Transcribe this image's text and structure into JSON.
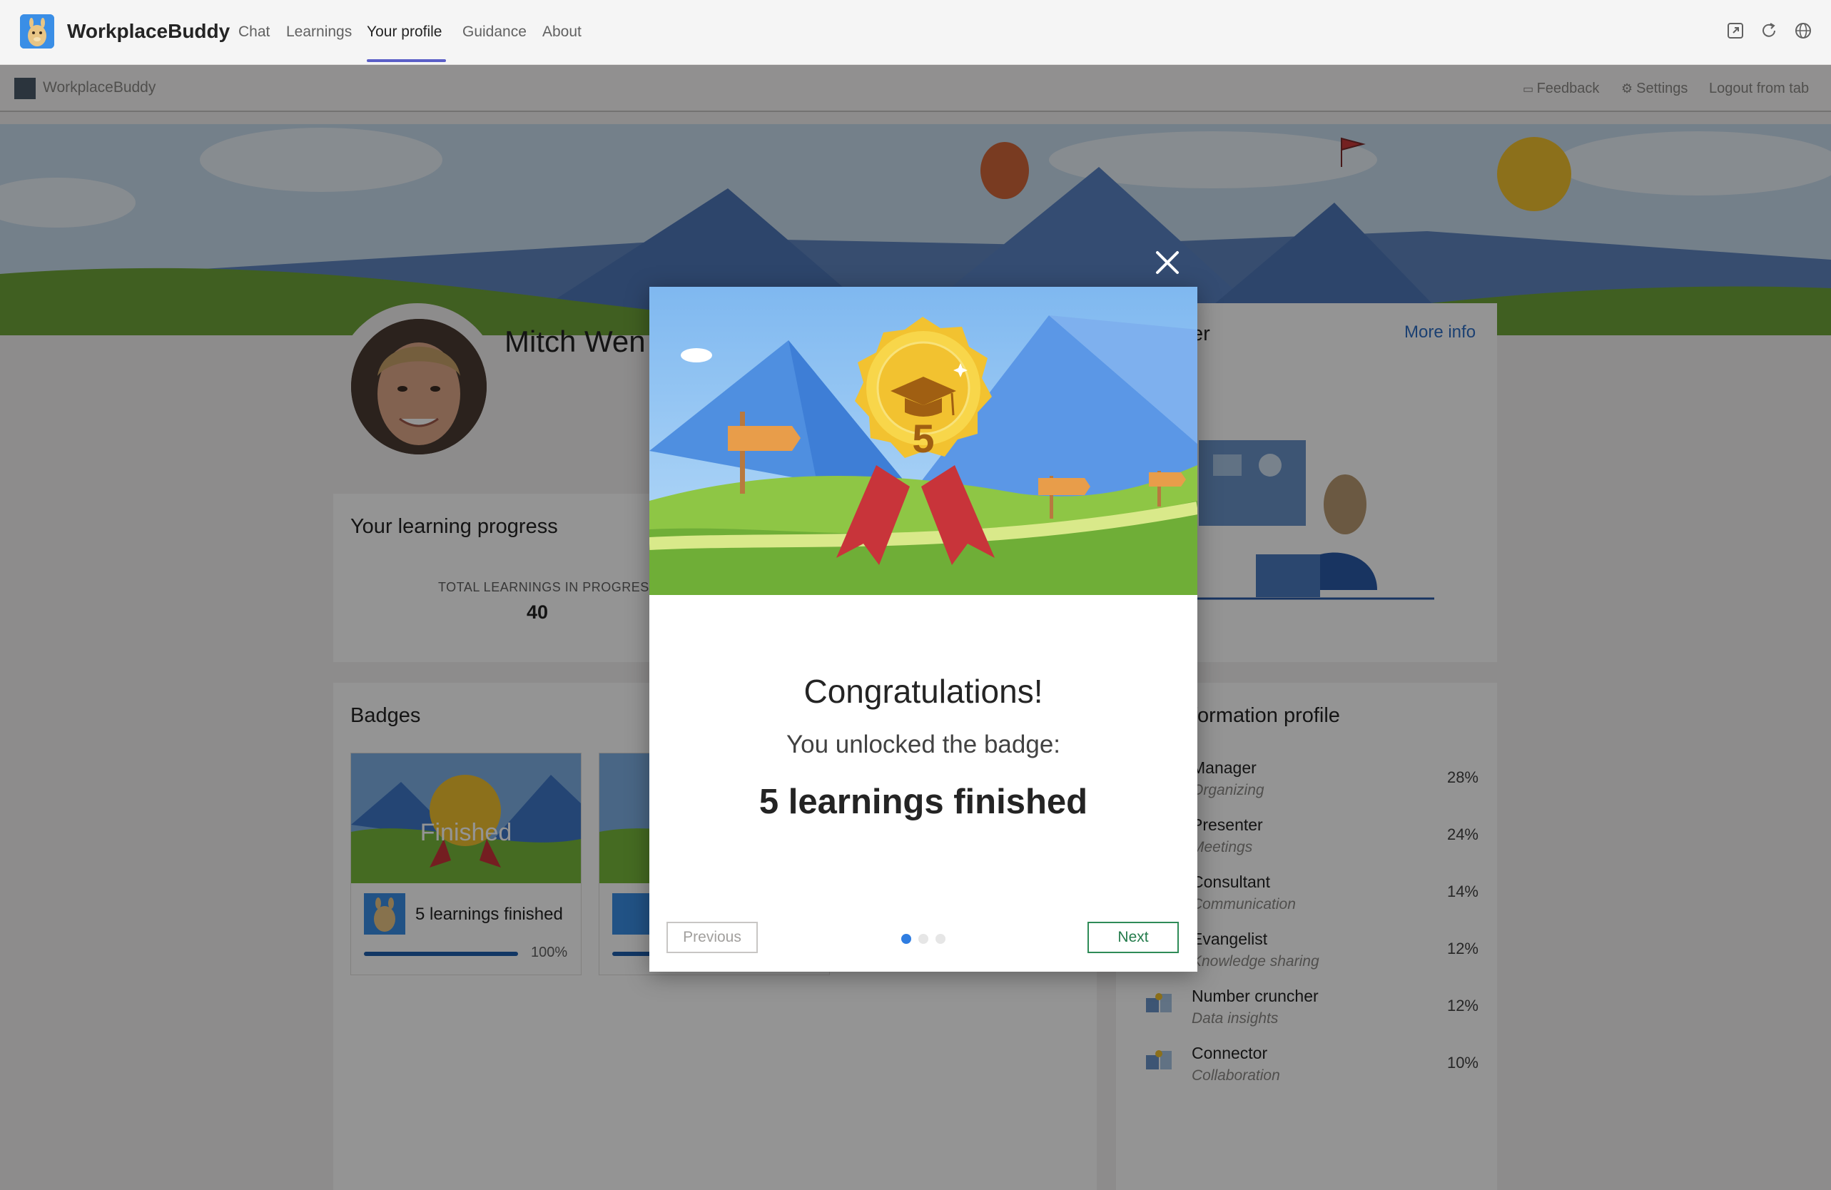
{
  "app": {
    "name": "WorkplaceBuddy",
    "tabs": [
      "Chat",
      "Learnings",
      "Your profile",
      "Guidance",
      "About"
    ],
    "active_tab": "Your profile"
  },
  "header_icons": [
    "popout-icon",
    "refresh-icon",
    "globe-icon"
  ],
  "subbar": {
    "title": "WorkplaceBuddy",
    "feedback": "Feedback",
    "settings": "Settings",
    "logout": "Logout from tab"
  },
  "profile": {
    "name": "Mitch Wen"
  },
  "learning_progress": {
    "title": "Your learning progress",
    "caption": "TOTAL LEARNINGS IN PROGRESS",
    "value": "40"
  },
  "type_card": {
    "title_fragment": "er",
    "more_info": "More info"
  },
  "badges": {
    "title": "Badges",
    "items": [
      {
        "overlay": "Finished",
        "label": "5 learnings finished",
        "pct_label": "100%",
        "progress": 1.0
      }
    ]
  },
  "transformation_profile": {
    "title_fragment": "formation profile",
    "rows": [
      {
        "name": "Manager",
        "sub": "Organizing",
        "pct": "28%"
      },
      {
        "name": "Presenter",
        "sub": "Meetings",
        "pct": "24%"
      },
      {
        "name": "Consultant",
        "sub": "Communication",
        "pct": "14%"
      },
      {
        "name": "Evangelist",
        "sub": "Knowledge sharing",
        "pct": "12%"
      },
      {
        "name": "Number cruncher",
        "sub": "Data insights",
        "pct": "12%"
      },
      {
        "name": "Connector",
        "sub": "Collaboration",
        "pct": "10%"
      }
    ]
  },
  "modal": {
    "title": "Congratulations!",
    "subtitle": "You unlocked the badge:",
    "badge_name": "5 learnings finished",
    "badge_number": "5",
    "prev_label": "Previous",
    "next_label": "Next",
    "page_count": 3,
    "current_page": 1
  },
  "colors": {
    "accent": "#5b5fc7",
    "link": "#2f6fc4",
    "progress": "#1f5fad",
    "next_green": "#237b4b",
    "badge_gold": "#f2c230",
    "ribbon_red": "#d8343a"
  }
}
